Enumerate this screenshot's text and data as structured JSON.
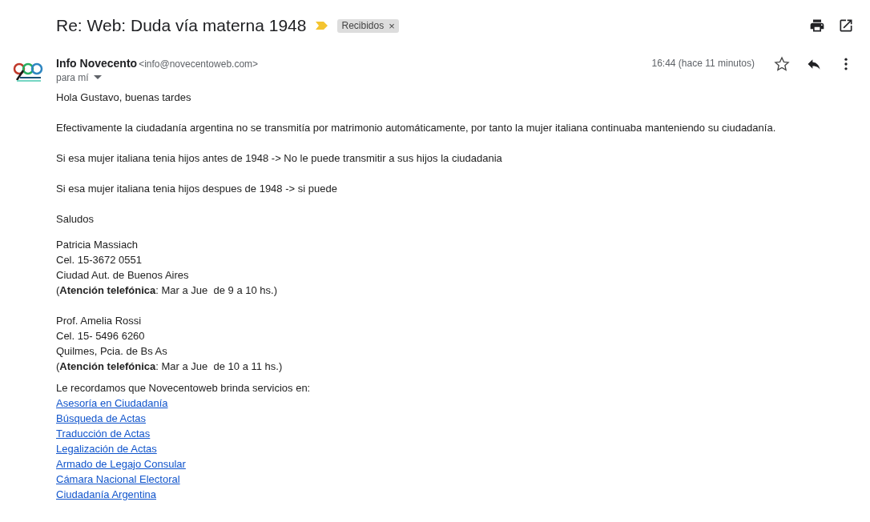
{
  "subject": "Re: Web: Duda vía materna 1948",
  "label": {
    "text": "Recibidos",
    "remove": "×"
  },
  "important": true,
  "sender": {
    "name": "Info Novecento",
    "email": "<info@novecentoweb.com>",
    "recipient": "para mí"
  },
  "time": "16:44 (hace 11 minutos)",
  "starred": false,
  "paragraphs": [
    "Hola Gustavo, buenas tardes",
    "Efectivamente la ciudadanía argentina no se transmitía por matrimonio automáticamente, por tanto la mujer italiana continuaba manteniendo su ciudadanía.",
    "Si esa mujer italiana tenia hijos antes de 1948 -> No le puede transmitir a sus hijos la ciudadania",
    "Si esa mujer italiana tenia hijos despues de 1948 -> si puede",
    "Saludos"
  ],
  "signatures": [
    [
      "Patricia Massiach",
      "Cel. 15-3672 0551",
      "Ciudad Aut. de Buenos Aires",
      "(**Atención telefónica**: Mar a Jue  de 9 a 10 hs.)"
    ],
    [
      "Prof. Amelia Rossi",
      "Cel. 15- 5496 6260",
      "Quilmes, Pcia. de Bs As",
      "(**Atención telefónica**: Mar a Jue  de 10 a 11 hs.)"
    ]
  ],
  "services_intro": "Le recordamos que Novecentoweb brinda servicios en:",
  "links": [
    "Asesoría en Ciudadanía",
    "Búsqueda de Actas",
    "Traducción de Actas",
    "Legalización de Actas",
    "Armado de Legajo Consular",
    "Cámara Nacional Electoral",
    "Ciudadanía Argentina"
  ]
}
